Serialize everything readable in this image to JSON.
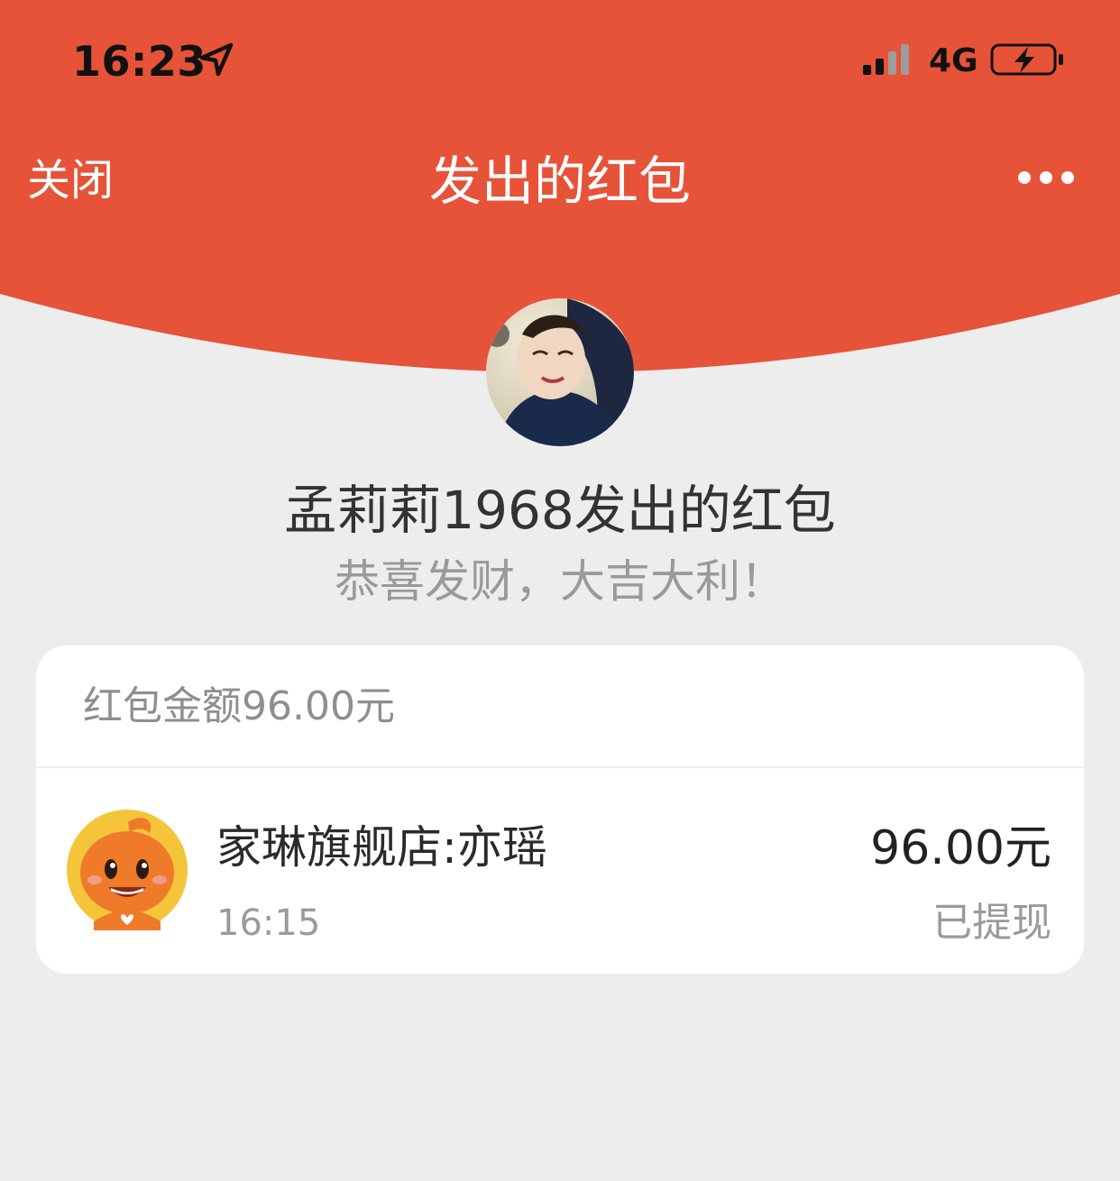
{
  "status_bar": {
    "time": "16:23",
    "network": "4G",
    "location_icon": "location-arrow-icon",
    "signal_icon": "signal-bars-icon",
    "battery_icon": "battery-charging-icon"
  },
  "nav": {
    "close_label": "关闭",
    "title": "发出的红包",
    "more_icon": "more-dots-icon"
  },
  "sender": {
    "name": "孟莉莉1968",
    "suffix": "发出的红包",
    "blessing": "恭喜发财，大吉大利！"
  },
  "summary": {
    "label": "红包金额",
    "amount": "96.00",
    "unit": "元"
  },
  "records": [
    {
      "name": "家琳旗舰店:亦瑶",
      "time": "16:15",
      "amount": "96.00元",
      "status": "已提现"
    }
  ],
  "colors": {
    "header_red": "#e65338",
    "background": "#ededed",
    "card": "#ffffff"
  }
}
